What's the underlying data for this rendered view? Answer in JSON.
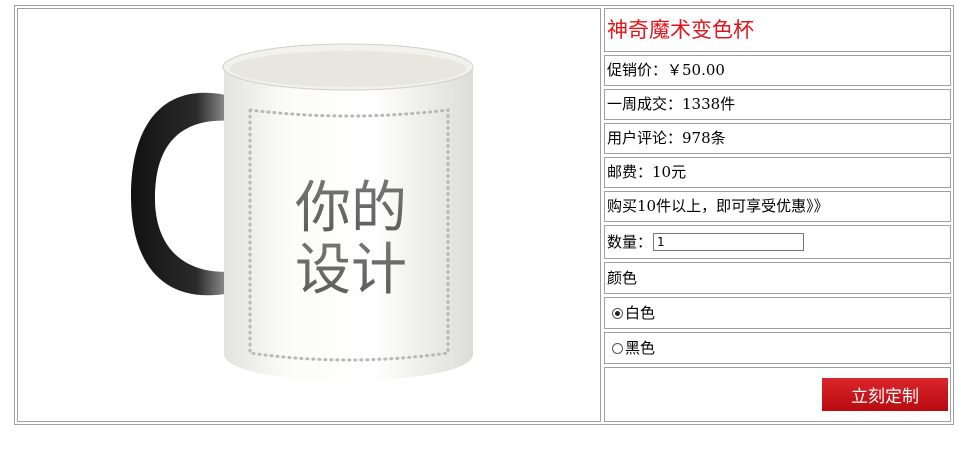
{
  "product": {
    "title": "神奇魔术变色杯",
    "price": "促销价：￥50.00",
    "weekly_sales": "一周成交：1338件",
    "reviews": "用户评论：978条",
    "shipping": "邮费：10元",
    "promo": "购买10件以上，即可享受优惠》》",
    "quantity_label": "数量：",
    "quantity_value": "1",
    "color_label": "颜色",
    "color_options": [
      {
        "label": "白色",
        "selected": true
      },
      {
        "label": "黑色",
        "selected": false
      }
    ],
    "customize_button": "立刻定制",
    "image_text_line1": "你的",
    "image_text_line2": "设计"
  },
  "colors": {
    "title_red": "#e4141b",
    "button_red": "#c4161c",
    "border_gray": "#a0a0a0"
  }
}
